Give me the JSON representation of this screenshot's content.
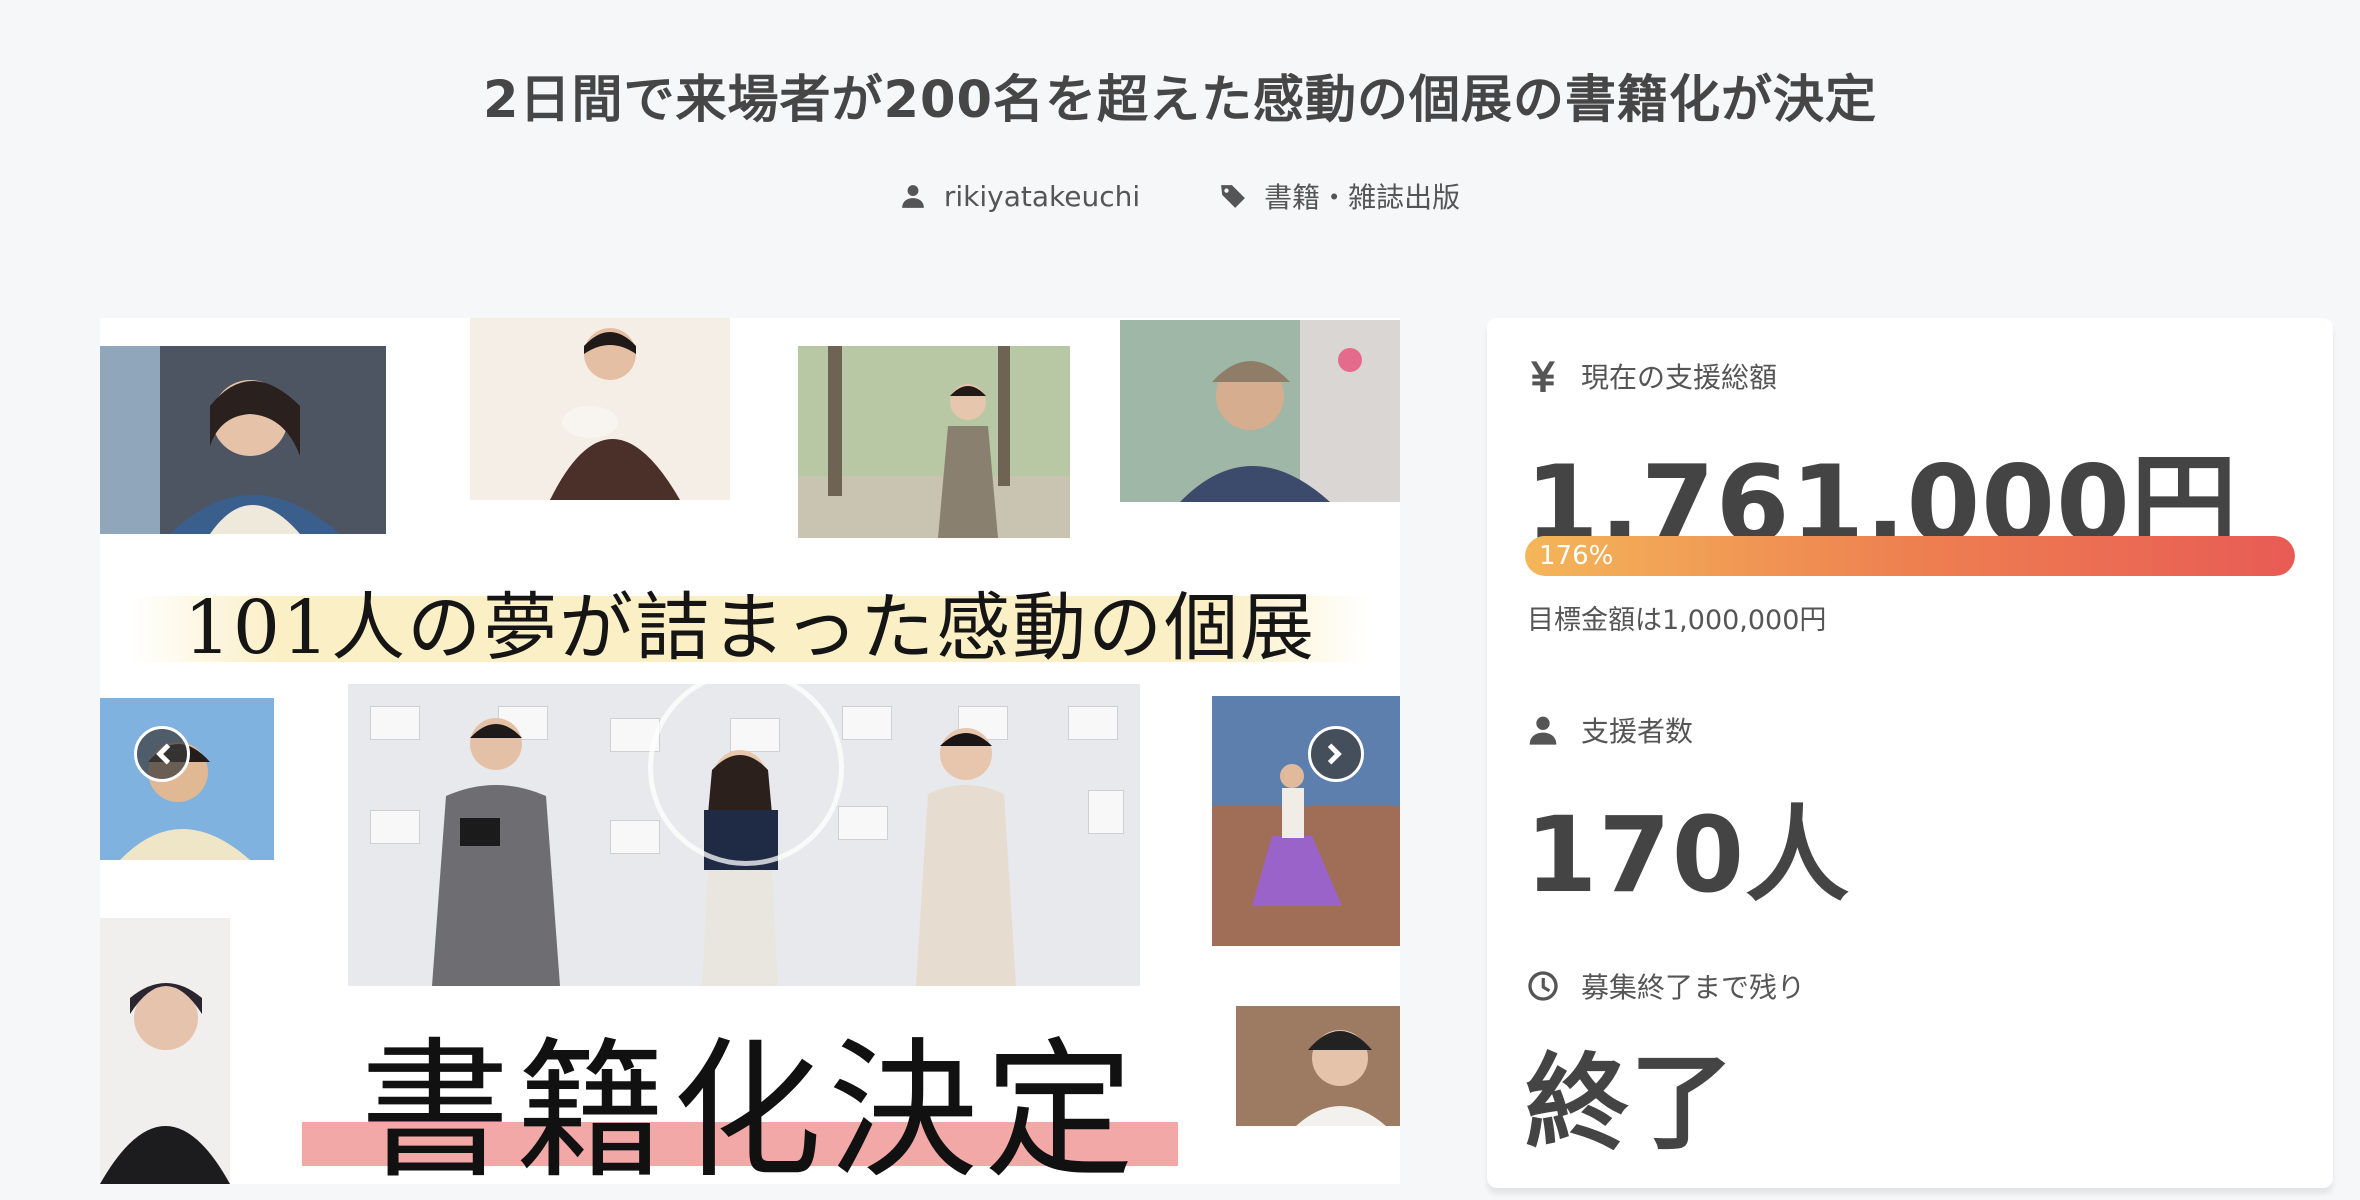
{
  "project": {
    "title": "2日間で来場者が200名を超えた感動の個展の書籍化が決定",
    "author": "rikiyatakeuchi",
    "category": "書籍・雑誌出版"
  },
  "banner": {
    "headline": "101人の夢が詰まった感動の個展",
    "decision_text": "書籍化決定"
  },
  "stats": {
    "total_label": "現在の支援総額",
    "total_amount": "1,761,000円",
    "progress_text": "176%",
    "progress_fraction": 1.0,
    "goal_text": "目標金額は1,000,000円",
    "backers_label": "支援者数",
    "backers_value": "170人",
    "remaining_label": "募集終了まで残り",
    "remaining_value": "終了"
  },
  "icons": {
    "author": "user-icon",
    "category": "tag-icon",
    "total": "yen-icon",
    "backers": "user-icon",
    "remaining": "clock-icon",
    "prev": "chevron-left-icon",
    "next": "chevron-right-icon"
  },
  "colors": {
    "progress_start": "#f4b659",
    "progress_end": "#e85b55",
    "accent_pink": "#f3a8a8",
    "text": "#444444"
  }
}
